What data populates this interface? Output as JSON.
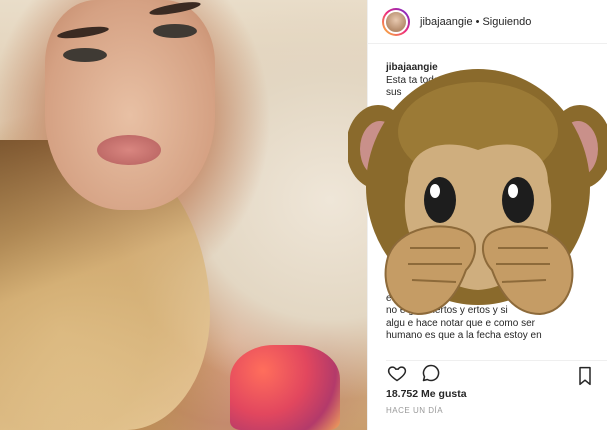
{
  "post": {
    "username": "jibajaangie",
    "follow_status": "Siguiendo",
    "caption_user": "jibajaangie",
    "caption_top_lines": "Esta ta                                   todos\nsus",
    "caption_bottom_text": "Ver                                               \nequi                                   ento que\nno e          go aciertos y                ertos y si\nalgu      e hace notar que e          como ser\nhumano es que a la fecha estoy en",
    "likes_count": "18.752",
    "likes_label": "Me gusta",
    "timestamp": "HACE UN DÍA"
  },
  "icons": {
    "like": "heart-outline-icon",
    "comment": "comment-bubble-icon",
    "save": "bookmark-icon",
    "overlay": "see-no-evil-monkey-emoji"
  },
  "colors": {
    "text": "#262626",
    "muted": "#999999",
    "monkey_fur": "#8a6a2c",
    "monkey_face": "#cfae7e"
  }
}
